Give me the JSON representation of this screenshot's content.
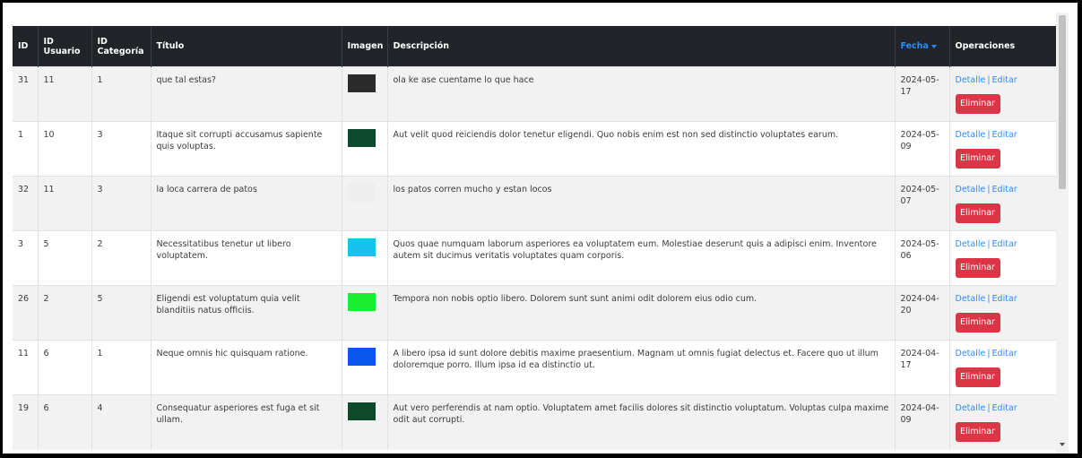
{
  "table": {
    "headers": {
      "id": "ID",
      "id_usuario_1": "ID",
      "id_usuario_2": "Usuario",
      "id_categoria_1": "ID",
      "id_categoria_2": "Categoría",
      "titulo": "Título",
      "imagen": "Imagen",
      "descripcion": "Descripción",
      "fecha": "Fecha",
      "operaciones": "Operaciones"
    },
    "actions": {
      "detalle": "Detalle",
      "separator": "|",
      "editar": "Editar",
      "eliminar": "Eliminar"
    },
    "rows": [
      {
        "id": "31",
        "usuario": "11",
        "categoria": "1",
        "titulo": "que tal estas?",
        "thumb_color": "#2b2b2b",
        "descripcion": "ola ke ase cuentame lo que hace",
        "fecha": "2024-05-17"
      },
      {
        "id": "1",
        "usuario": "10",
        "categoria": "3",
        "titulo": "Itaque sit corrupti accusamus sapiente quis voluptas.",
        "thumb_color": "#0b4a2e",
        "descripcion": "Aut velit quod reiciendis dolor tenetur eligendi. Quo nobis enim est non sed distinctio voluptates earum.",
        "fecha": "2024-05-09"
      },
      {
        "id": "32",
        "usuario": "11",
        "categoria": "3",
        "titulo": "la loca carrera de patos",
        "thumb_color": "#eeeeee",
        "descripcion": "los patos corren mucho y estan locos",
        "fecha": "2024-05-07"
      },
      {
        "id": "3",
        "usuario": "5",
        "categoria": "2",
        "titulo": "Necessitatibus tenetur ut libero voluptatem.",
        "thumb_color": "#17c3ee",
        "descripcion": "Quos quae numquam laborum asperiores ea voluptatem eum. Molestiae deserunt quis a adipisci enim. Inventore autem sit ducimus veritatis voluptates quam corporis.",
        "fecha": "2024-05-06"
      },
      {
        "id": "26",
        "usuario": "2",
        "categoria": "5",
        "titulo": "Eligendi est voluptatum quia velit blanditiis natus officiis.",
        "thumb_color": "#1aee2e",
        "descripcion": "Tempora non nobis optio libero. Dolorem sunt sunt animi odit dolorem eius odio cum.",
        "fecha": "2024-04-20"
      },
      {
        "id": "11",
        "usuario": "6",
        "categoria": "1",
        "titulo": "Neque omnis hic quisquam ratione.",
        "thumb_color": "#0a55ee",
        "descripcion": "A libero ipsa id sunt dolore debitis maxime praesentium. Magnam ut omnis fugiat delectus et. Facere quo ut illum doloremque porro. Illum ipsa id ea distinctio ut.",
        "fecha": "2024-04-17"
      },
      {
        "id": "19",
        "usuario": "6",
        "categoria": "4",
        "titulo": "Consequatur asperiores est fuga et sit ullam.",
        "thumb_color": "#0e4a2a",
        "descripcion": "Aut vero perferendis at nam optio. Voluptatem amet facilis dolores sit distinctio voluptatum. Voluptas culpa maxime odit aut corrupti.",
        "fecha": "2024-04-09"
      }
    ]
  },
  "colors": {
    "header_bg": "#212529",
    "link": "#2b8cff",
    "danger": "#dc3545",
    "stripe": "#f2f2f2"
  }
}
